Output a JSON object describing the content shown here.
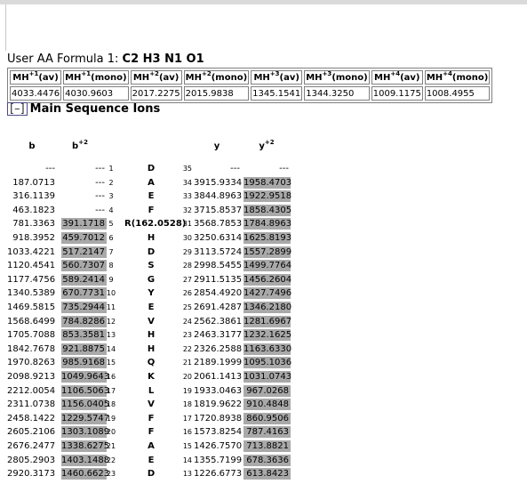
{
  "formula": {
    "label": "User AA Formula 1: ",
    "value": "C2 H3 N1 O1"
  },
  "mh_table": {
    "headers": [
      {
        "base": "MH",
        "sup": "+1",
        "suffix": "(av)"
      },
      {
        "base": "MH",
        "sup": "+1",
        "suffix": "(mono)"
      },
      {
        "base": "MH",
        "sup": "+2",
        "suffix": "(av)"
      },
      {
        "base": "MH",
        "sup": "+2",
        "suffix": "(mono)"
      },
      {
        "base": "MH",
        "sup": "+3",
        "suffix": "(av)"
      },
      {
        "base": "MH",
        "sup": "+3",
        "suffix": "(mono)"
      },
      {
        "base": "MH",
        "sup": "+4",
        "suffix": "(av)"
      },
      {
        "base": "MH",
        "sup": "+4",
        "suffix": "(mono)"
      }
    ],
    "values": [
      "4033.4476",
      "4030.9603",
      "2017.2275",
      "2015.9838",
      "1345.1541",
      "1344.3250",
      "1009.1175",
      "1008.4955"
    ]
  },
  "section": {
    "toggle": "[–]",
    "title": "Main Sequence Ions"
  },
  "ions": {
    "headers": {
      "b": "b",
      "b2": "b",
      "b2_sup": "+2",
      "y": "y",
      "y2": "y",
      "y2_sup": "+2"
    },
    "rows": [
      {
        "b": "---",
        "b2": "---",
        "b2_hl": false,
        "bn": "1",
        "aa": "D",
        "yn": "35",
        "y": "---",
        "y2": "---",
        "y2_hl": false
      },
      {
        "b": "187.0713",
        "b2": "---",
        "b2_hl": false,
        "bn": "2",
        "aa": "A",
        "yn": "34",
        "y": "3915.9334",
        "y2": "1958.4703",
        "y2_hl": true
      },
      {
        "b": "316.1139",
        "b2": "---",
        "b2_hl": false,
        "bn": "3",
        "aa": "E",
        "yn": "33",
        "y": "3844.8963",
        "y2": "1922.9518",
        "y2_hl": true
      },
      {
        "b": "463.1823",
        "b2": "---",
        "b2_hl": false,
        "bn": "4",
        "aa": "F",
        "yn": "32",
        "y": "3715.8537",
        "y2": "1858.4305",
        "y2_hl": true
      },
      {
        "b": "781.3363",
        "b2": "391.1718",
        "b2_hl": true,
        "bn": "5",
        "aa": "R(162.0528)",
        "yn": "31",
        "y": "3568.7853",
        "y2": "1784.8963",
        "y2_hl": true
      },
      {
        "b": "918.3952",
        "b2": "459.7012",
        "b2_hl": true,
        "bn": "6",
        "aa": "H",
        "yn": "30",
        "y": "3250.6314",
        "y2": "1625.8193",
        "y2_hl": true
      },
      {
        "b": "1033.4221",
        "b2": "517.2147",
        "b2_hl": true,
        "bn": "7",
        "aa": "D",
        "yn": "29",
        "y": "3113.5724",
        "y2": "1557.2899",
        "y2_hl": true
      },
      {
        "b": "1120.4541",
        "b2": "560.7307",
        "b2_hl": true,
        "bn": "8",
        "aa": "S",
        "yn": "28",
        "y": "2998.5455",
        "y2": "1499.7764",
        "y2_hl": true
      },
      {
        "b": "1177.4756",
        "b2": "589.2414",
        "b2_hl": true,
        "bn": "9",
        "aa": "G",
        "yn": "27",
        "y": "2911.5135",
        "y2": "1456.2604",
        "y2_hl": true
      },
      {
        "b": "1340.5389",
        "b2": "670.7731",
        "b2_hl": true,
        "bn": "10",
        "aa": "Y",
        "yn": "26",
        "y": "2854.4920",
        "y2": "1427.7496",
        "y2_hl": true
      },
      {
        "b": "1469.5815",
        "b2": "735.2944",
        "b2_hl": true,
        "bn": "11",
        "aa": "E",
        "yn": "25",
        "y": "2691.4287",
        "y2": "1346.2180",
        "y2_hl": true
      },
      {
        "b": "1568.6499",
        "b2": "784.8286",
        "b2_hl": true,
        "bn": "12",
        "aa": "V",
        "yn": "24",
        "y": "2562.3861",
        "y2": "1281.6967",
        "y2_hl": true
      },
      {
        "b": "1705.7088",
        "b2": "853.3581",
        "b2_hl": true,
        "bn": "13",
        "aa": "H",
        "yn": "23",
        "y": "2463.3177",
        "y2": "1232.1625",
        "y2_hl": true
      },
      {
        "b": "1842.7678",
        "b2": "921.8875",
        "b2_hl": true,
        "bn": "14",
        "aa": "H",
        "yn": "22",
        "y": "2326.2588",
        "y2": "1163.6330",
        "y2_hl": true
      },
      {
        "b": "1970.8263",
        "b2": "985.9168",
        "b2_hl": true,
        "bn": "15",
        "aa": "Q",
        "yn": "21",
        "y": "2189.1999",
        "y2": "1095.1036",
        "y2_hl": true
      },
      {
        "b": "2098.9213",
        "b2": "1049.9643",
        "b2_hl": true,
        "bn": "16",
        "aa": "K",
        "yn": "20",
        "y": "2061.1413",
        "y2": "1031.0743",
        "y2_hl": true
      },
      {
        "b": "2212.0054",
        "b2": "1106.5063",
        "b2_hl": true,
        "bn": "17",
        "aa": "L",
        "yn": "19",
        "y": "1933.0463",
        "y2": "967.0268",
        "y2_hl": true
      },
      {
        "b": "2311.0738",
        "b2": "1156.0405",
        "b2_hl": true,
        "bn": "18",
        "aa": "V",
        "yn": "18",
        "y": "1819.9622",
        "y2": "910.4848",
        "y2_hl": true
      },
      {
        "b": "2458.1422",
        "b2": "1229.5747",
        "b2_hl": true,
        "bn": "19",
        "aa": "F",
        "yn": "17",
        "y": "1720.8938",
        "y2": "860.9506",
        "y2_hl": true
      },
      {
        "b": "2605.2106",
        "b2": "1303.1089",
        "b2_hl": true,
        "bn": "20",
        "aa": "F",
        "yn": "16",
        "y": "1573.8254",
        "y2": "787.4163",
        "y2_hl": true
      },
      {
        "b": "2676.2477",
        "b2": "1338.6275",
        "b2_hl": true,
        "bn": "21",
        "aa": "A",
        "yn": "15",
        "y": "1426.7570",
        "y2": "713.8821",
        "y2_hl": true
      },
      {
        "b": "2805.2903",
        "b2": "1403.1488",
        "b2_hl": true,
        "bn": "22",
        "aa": "E",
        "yn": "14",
        "y": "1355.7199",
        "y2": "678.3636",
        "y2_hl": true
      },
      {
        "b": "2920.3173",
        "b2": "1460.6623",
        "b2_hl": true,
        "bn": "23",
        "aa": "D",
        "yn": "13",
        "y": "1226.6773",
        "y2": "613.8423",
        "y2_hl": true
      }
    ]
  }
}
